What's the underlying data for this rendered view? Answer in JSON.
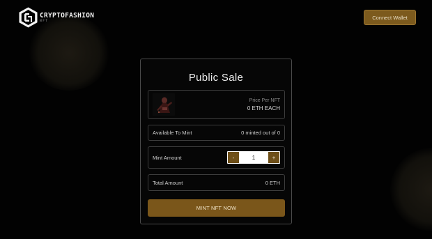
{
  "header": {
    "logo_name": "CRYPTOFASHION",
    "logo_sub": "NFT",
    "connect_label": "Connect Wallet"
  },
  "sale": {
    "title": "Public Sale",
    "price_label": "Price Per NFT",
    "price_value": "0 ETH EACH",
    "available_label": "Available To Mint",
    "available_value": "0 minted out of 0",
    "mint_amount_label": "Mint Amount",
    "decrement_label": "-",
    "increment_label": "+",
    "mint_amount_value": "1",
    "total_label": "Total Amount",
    "total_value": "0 ETH",
    "mint_button_label": "MINT NFT NOW"
  },
  "icons": {
    "logo": "cryptofashion-logo-icon",
    "thumbnail": "nft-thumbnail-image"
  },
  "colors": {
    "accent": "#7a561a",
    "background": "#020202",
    "card_border": "#4a4a4a"
  }
}
